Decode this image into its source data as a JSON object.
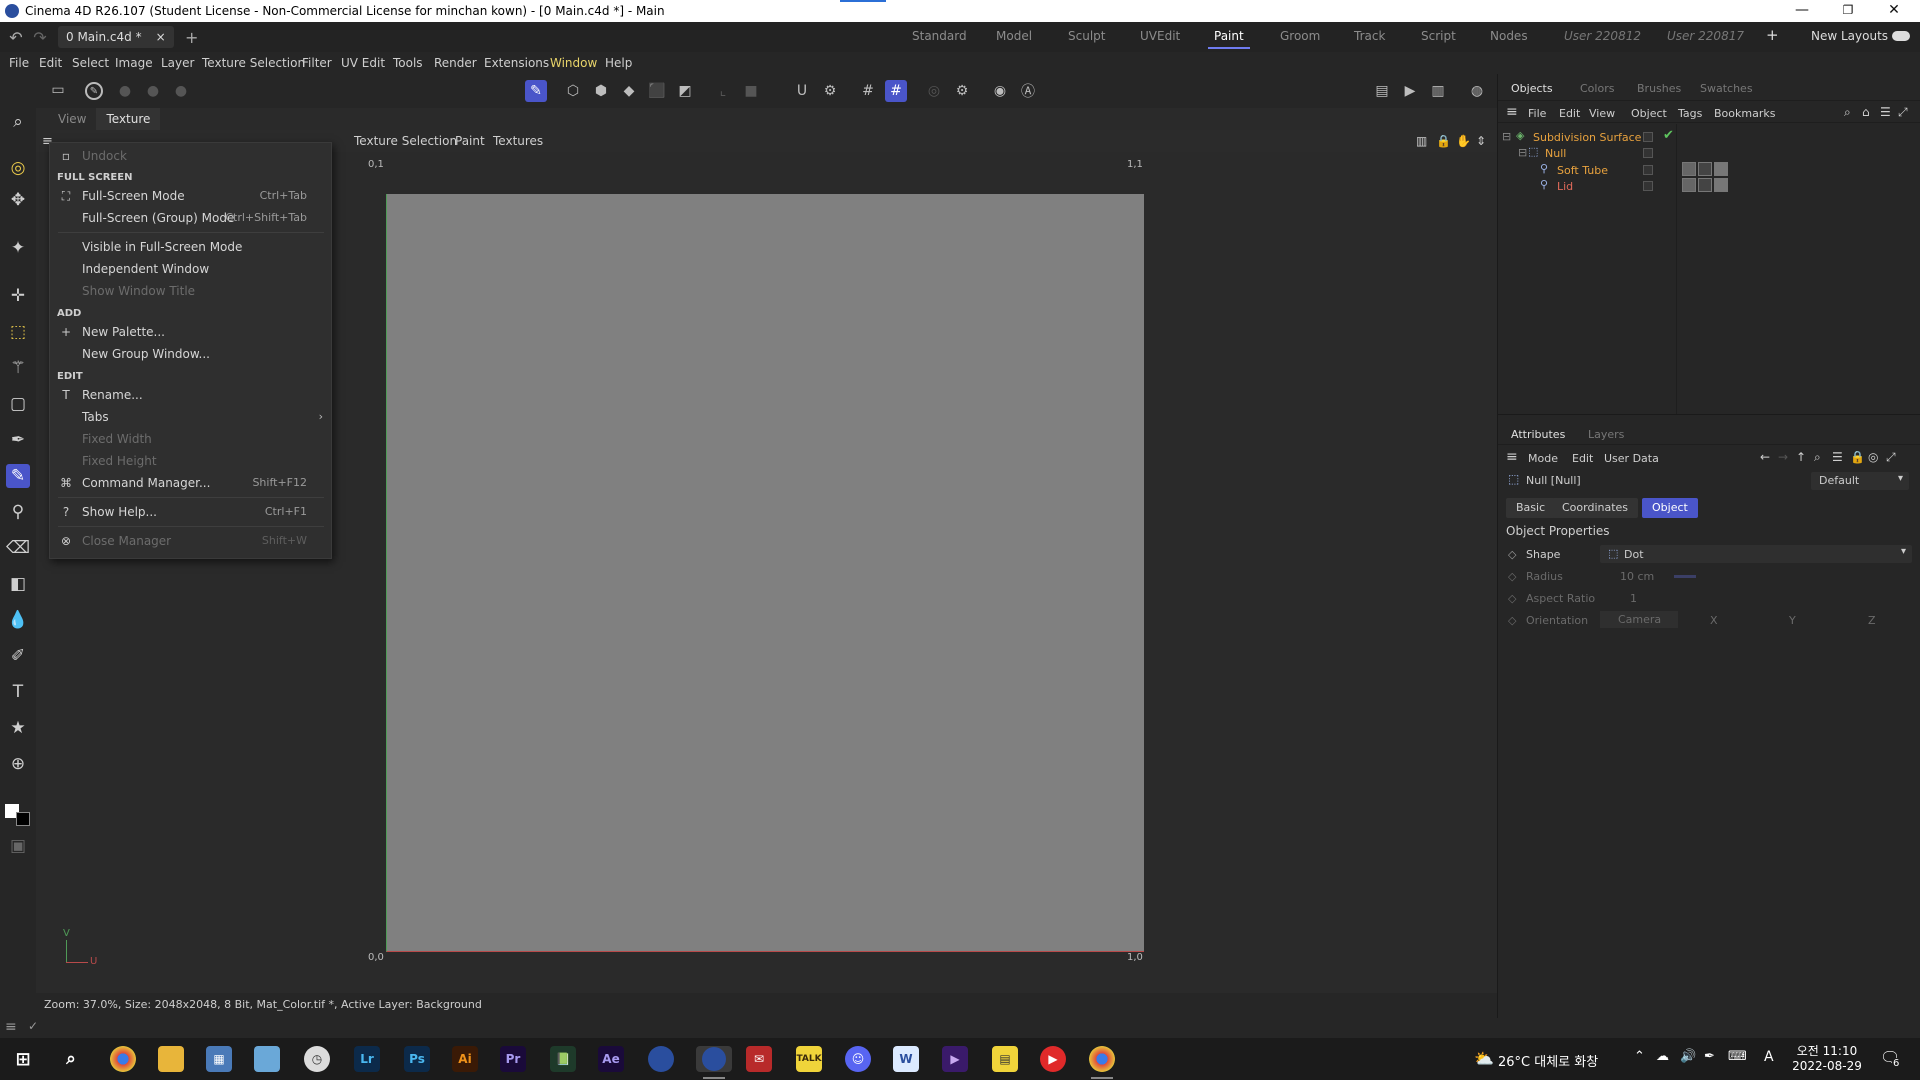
{
  "titlebar": {
    "title": "Cinema 4D R26.107 (Student License - Non-Commercial License for minchan kown) - [0 Main.c4d *] - Main"
  },
  "tabbar": {
    "doc_tab": "0 Main.c4d *",
    "close": "×",
    "add": "+",
    "layouts": [
      "Standard",
      "Model",
      "Sculpt",
      "UVEdit",
      "Paint",
      "Groom",
      "Track",
      "Script",
      "Nodes"
    ],
    "active_layout": "Paint",
    "user_layouts": [
      "User 220812",
      "User 220817"
    ],
    "new_layouts": "New Layouts"
  },
  "menubar": [
    "File",
    "Edit",
    "Select",
    "Image",
    "Layer",
    "Texture Selection",
    "Filter",
    "UV Edit",
    "Tools",
    "Render",
    "Extensions",
    "Window",
    "Help"
  ],
  "viewport": {
    "tabs": [
      "View",
      "Texture"
    ],
    "menu_visible": [
      "Texture Selection",
      "Paint",
      "Textures"
    ],
    "corners": {
      "tl": "0,1",
      "tr": "1,1",
      "bl": "0,0",
      "br": "1,0"
    },
    "axis": {
      "v": "V",
      "u": "U"
    }
  },
  "status": "Zoom: 37.0%, Size: 2048x2048, 8 Bit, Mat_Color.tif *, Active Layer: Background",
  "dropdown": {
    "undock": "Undock",
    "h_fullscreen": "FULL SCREEN",
    "fullscreen": {
      "label": "Full-Screen Mode",
      "shortcut": "Ctrl+Tab"
    },
    "fullscreen_group": {
      "label": "Full-Screen (Group) Mode",
      "shortcut": "Ctrl+Shift+Tab"
    },
    "visible_fs": "Visible in Full-Screen Mode",
    "independent": "Independent Window",
    "show_title": "Show Window Title",
    "h_add": "ADD",
    "new_palette": "New Palette...",
    "new_group": "New Group Window...",
    "h_edit": "EDIT",
    "rename": "Rename...",
    "tabs": "Tabs",
    "fixed_width": "Fixed Width",
    "fixed_height": "Fixed Height",
    "command_manager": {
      "label": "Command Manager...",
      "shortcut": "Shift+F12"
    },
    "show_help": {
      "label": "Show Help...",
      "shortcut": "Ctrl+F1"
    },
    "close_manager": {
      "label": "Close Manager",
      "shortcut": "Shift+W"
    }
  },
  "objects_panel": {
    "tabs": [
      "Objects",
      "Colors",
      "Brushes",
      "Swatches"
    ],
    "menu": [
      "File",
      "Edit",
      "View",
      "Object",
      "Tags",
      "Bookmarks"
    ],
    "items": [
      "Subdivision Surface",
      "Null",
      "Soft Tube",
      "Lid"
    ]
  },
  "attributes_panel": {
    "tabs": [
      "Attributes",
      "Layers"
    ],
    "menu": [
      "Mode",
      "Edit",
      "User Data"
    ],
    "object_name": "Null [Null]",
    "preset": "Default",
    "subtabs": [
      "Basic",
      "Coordinates",
      "Object"
    ],
    "section": "Object Properties",
    "shape": {
      "label": "Shape",
      "value": "Dot"
    },
    "radius": {
      "label": "Radius",
      "value": "10 cm"
    },
    "aspect": {
      "label": "Aspect Ratio",
      "value": "1"
    },
    "orientation": {
      "label": "Orientation",
      "value": "Camera",
      "x": "X",
      "y": "Y",
      "z": "Z"
    }
  },
  "taskbar": {
    "weather": "26°C 대체로 화창",
    "time": "오전 11:10",
    "date": "2022-08-29",
    "ime": "A",
    "notif_count": "6",
    "apps": [
      "Lr",
      "Ps",
      "Ai",
      "Pr",
      "Ae"
    ]
  },
  "colors": {
    "accent": "#4a55c9",
    "highlight_menu": "#e8d46a",
    "object_orange": "#e8a23e",
    "object_red": "#e06a5a"
  }
}
